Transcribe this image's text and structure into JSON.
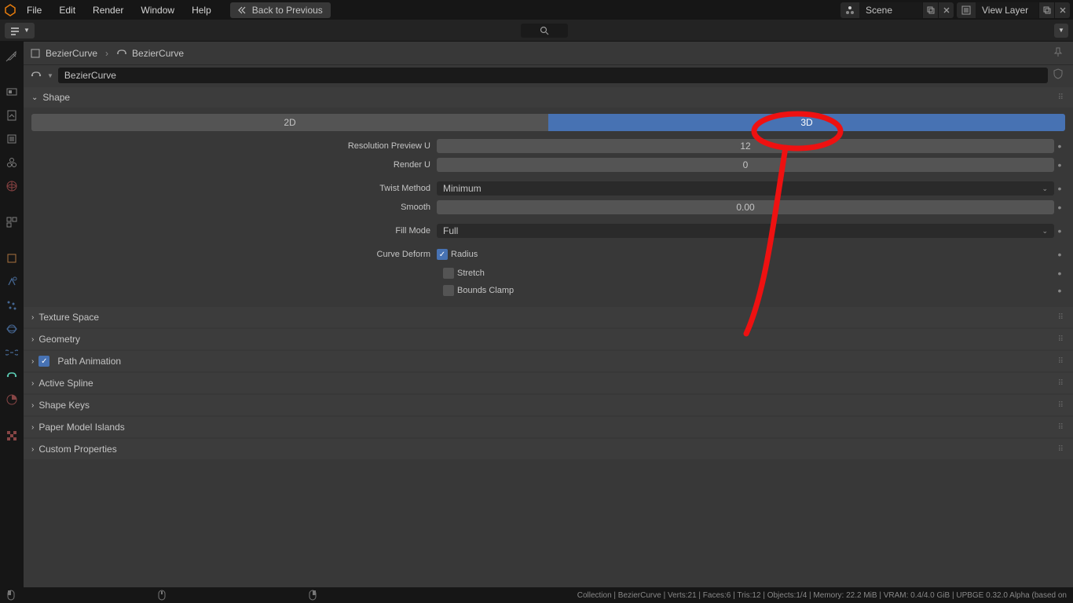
{
  "menu": {
    "items": [
      "File",
      "Edit",
      "Render",
      "Window",
      "Help"
    ],
    "back": "Back to Previous"
  },
  "top_right": {
    "scene": "Scene",
    "view_layer": "View Layer"
  },
  "breadcrumb": {
    "item1": "BezierCurve",
    "item2": "BezierCurve"
  },
  "name_field": "BezierCurve",
  "panels": {
    "shape": "Shape",
    "texture_space": "Texture Space",
    "geometry": "Geometry",
    "path_animation": "Path Animation",
    "active_spline": "Active Spline",
    "shape_keys": "Shape Keys",
    "paper_model": "Paper Model Islands",
    "custom_props": "Custom Properties"
  },
  "shape": {
    "toggle_2d": "2D",
    "toggle_3d": "3D",
    "resolution_preview": "Resolution Preview U",
    "resolution_preview_val": "12",
    "render_u": "Render U",
    "render_u_val": "0",
    "twist_method": "Twist Method",
    "twist_method_val": "Minimum",
    "smooth": "Smooth",
    "smooth_val": "0.00",
    "fill_mode": "Fill Mode",
    "fill_mode_val": "Full",
    "curve_deform": "Curve Deform",
    "radius": "Radius",
    "stretch": "Stretch",
    "bounds_clamp": "Bounds Clamp"
  },
  "status": {
    "text": "Collection | BezierCurve | Verts:21 | Faces:6 | Tris:12 | Objects:1/4 | Memory: 22.2 MiB | VRAM: 0.4/4.0 GiB | UPBGE 0.32.0 Alpha (based on"
  },
  "colors": {
    "selected": "#4772b3",
    "bg_dark": "#161616",
    "bg_med": "#383838",
    "accent": "#5bccb4"
  }
}
